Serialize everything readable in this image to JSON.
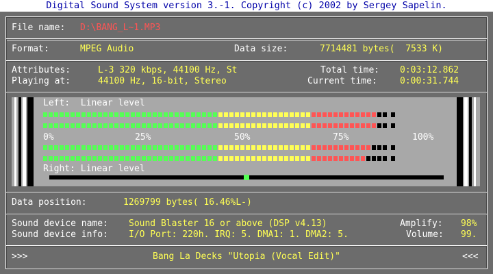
{
  "title": "Digital Sound System version 3.-1. Copyright (c) 2002 by Sergey Sapelin.",
  "file": {
    "label": "File name:",
    "value": "D:\\BANG_L~1.MP3"
  },
  "format": {
    "label": "Format:",
    "value": "MPEG Audio",
    "size_label": "Data size:",
    "size_value": "7714481 bytes(  7533 K)"
  },
  "info": {
    "attributes_label": "Attributes:",
    "attributes_value": "L-3 320 kbps, 44100 Hz, St",
    "playing_label": "Playing at:",
    "playing_value": "44100 Hz, 16-bit, Stereo",
    "total_label": "Total time:",
    "total_value": "0:03:12.862",
    "current_label": "Current time:",
    "current_value": "0:00:31.744"
  },
  "meter": {
    "left_label": "Left:  Linear level",
    "right_label": "Right: Linear level",
    "ticks": [
      "0%",
      "25%",
      "50%",
      "75%",
      "100%"
    ],
    "segments_total": 64,
    "green_segments": 32,
    "yellow_segments": 17,
    "red_segments": 11,
    "rows": [
      {
        "lit": 61
      },
      {
        "lit": 61
      },
      {
        "lit": 60
      },
      {
        "lit": 59
      }
    ],
    "position_fraction": 0.5,
    "colors": {
      "green": "#55ff55",
      "yellow": "#ffff55",
      "red": "#ff5555",
      "off": "#000000"
    }
  },
  "position": {
    "label": "Data position:",
    "value": "1269799 bytes( 16.46%L-)"
  },
  "device": {
    "name_label": "Sound device name:",
    "name_value": "Sound Blaster 16 or above (DSP v4.13)",
    "info_label": "Sound device info:",
    "info_value": "I/O Port: 220h. IRQ: 5. DMA1: 1. DMA2: 5.",
    "amplify_label": "Amplify:",
    "amplify_value": "98%",
    "volume_label": "Volume:",
    "volume_value": "99."
  },
  "track": {
    "prev_label": ">>>",
    "next_label": "<<<",
    "name": "Bang La Decks \"Utopia (Vocal Edit)\""
  }
}
